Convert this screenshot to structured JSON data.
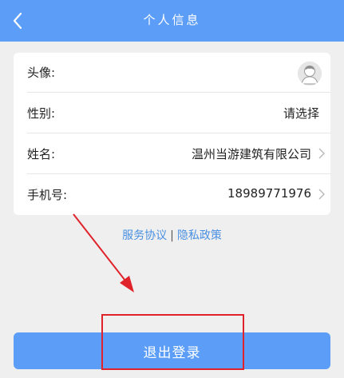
{
  "header": {
    "title": "个人信息",
    "back_icon": "chevron-left-icon",
    "bg_color": "#5b9df7"
  },
  "profile": {
    "avatar": {
      "label": "头像:",
      "icon": "default-avatar-icon"
    },
    "gender": {
      "label": "性别:",
      "value": "请选择"
    },
    "name": {
      "label": "姓名:",
      "value": "温州当游建筑有限公司"
    },
    "phone": {
      "label": "手机号:",
      "value": "18989771976"
    }
  },
  "links": {
    "service": "服务协议",
    "separator": "|",
    "privacy": "隐私政策",
    "color": "#4a90e2"
  },
  "logout": {
    "label": "退出登录",
    "color": "#5b9df7"
  },
  "annotation": {
    "arrow_color": "#e0232b",
    "box_color": "#e0232b"
  }
}
